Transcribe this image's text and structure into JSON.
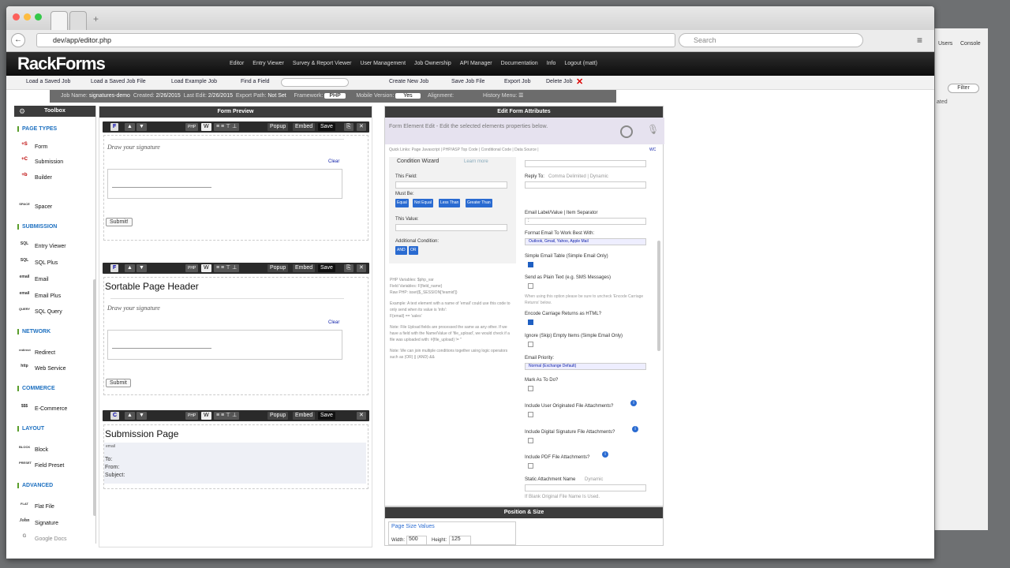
{
  "browser": {
    "url": "dev/app/editor.php",
    "search_placeholder": "Search"
  },
  "app": {
    "logo": "RackForms",
    "nav": [
      "Editor",
      "Entry Viewer",
      "Survey & Report Viewer",
      "User Management",
      "Job Ownership",
      "API Manager",
      "Documentation",
      "Info",
      "Logout (matt)"
    ]
  },
  "toolbar": {
    "load_saved_job": "Load a Saved Job",
    "load_saved_job_file": "Load a Saved Job File",
    "load_example_job": "Load Example Job",
    "find_field": "Find a Field",
    "create_new_job": "Create New Job",
    "save_job_file": "Save Job File",
    "export_job": "Export Job",
    "delete_job": "Delete Job"
  },
  "meta": {
    "job_name_label": "Job Name:",
    "job_name": "signatures-demo",
    "created_label": "Created:",
    "created": "2/26/2015",
    "last_edit_label": "Last Edit:",
    "last_edit": "2/26/2015",
    "export_path_label": "Export Path:",
    "export_path": "Not Set",
    "framework_label": "Framework:",
    "framework": "PHP",
    "mobile_label": "Mobile Version:",
    "mobile": "Yes",
    "alignment_label": "Alignment:",
    "history_label": "History Menu:"
  },
  "toolbox": {
    "title": "Toolbox",
    "sections": [
      {
        "name": "PAGE TYPES",
        "items": [
          {
            "icon": "+S",
            "label": "Form"
          },
          {
            "icon": "+C",
            "label": "Submission"
          },
          {
            "icon": "+b",
            "label": "Builder"
          }
        ]
      },
      {
        "name": "",
        "items": [
          {
            "icon": "SPACE",
            "label": "Spacer"
          }
        ]
      },
      {
        "name": "SUBMISSION",
        "items": [
          {
            "icon": "SQL",
            "label": "Entry Viewer"
          },
          {
            "icon": "SQL",
            "label": "SQL Plus"
          },
          {
            "icon": "email",
            "label": "Email"
          },
          {
            "icon": "email",
            "label": "Email Plus"
          },
          {
            "icon": "QUERY",
            "label": "SQL Query"
          }
        ]
      },
      {
        "name": "NETWORK",
        "items": [
          {
            "icon": "redirect",
            "label": "Redirect"
          },
          {
            "icon": "http",
            "label": "Web Service"
          }
        ]
      },
      {
        "name": "COMMERCE",
        "items": [
          {
            "icon": "$$$",
            "label": "E-Commerce"
          }
        ]
      },
      {
        "name": "LAYOUT",
        "items": [
          {
            "icon": "BLOCK",
            "label": "Block"
          },
          {
            "icon": "PRESET",
            "label": "Field Preset"
          }
        ]
      },
      {
        "name": "ADVANCED",
        "items": [
          {
            "icon": "FLAT",
            "label": "Flat File"
          },
          {
            "icon": "John",
            "label": "Signature"
          },
          {
            "icon": "G",
            "label": "Google Docs"
          }
        ]
      }
    ]
  },
  "preview": {
    "title": "Form Preview",
    "controls": {
      "popup": "Popup",
      "embed": "Embed",
      "save": "Save",
      "php": "PHP",
      "w": "W"
    },
    "page1": {
      "type": "F",
      "sig_label": "Draw your signature",
      "clear": "Clear",
      "submit": "Submit!"
    },
    "page2": {
      "type": "F",
      "header": "Sortable Page Header",
      "sig_label": "Draw your signature",
      "clear": "Clear",
      "submit": "Submit"
    },
    "page3": {
      "type": "C",
      "header": "Submission Page",
      "email_icon": "email",
      "to": "To:",
      "from": "From:",
      "subject": "Subject:"
    }
  },
  "editor": {
    "title": "Edit Form Attributes",
    "subtitle": "Form Element Edit - Edit the selected elements properties below.",
    "quicklinks": "Quick Links: Page Javascript | PHP/ASP Top Code | Conditional Code | Data Source |",
    "wc": "WC",
    "left": {
      "wizard": "Condition Wizard",
      "learn": "Learn more",
      "this_field": "This Field:",
      "must_be": "Must Be:",
      "ops": [
        "Equal",
        "Not Equal",
        "Less Than",
        "Greater Than"
      ],
      "this_value": "This Value:",
      "additional": "Additional Condition:",
      "and": "AND",
      "or": "OR",
      "php_vars": "PHP Variables: $php_var",
      "field_vars": "Field Variables: F{field_name}",
      "raw_php": "Raw PHP: isset($_SESSION['teamid'])",
      "p1": "Example: A text element with a name of 'email' could use this code to only send when its value is 'info':",
      "p1b": "F{email} == 'sales'",
      "p2": "Note: File Upload fields are processed the same as any other. If we have a field with the Name/Value of 'file_upload', we would check if a file was uploaded with: #{file_upload} != ''",
      "p3": "Note: We can join multiple conditions together using logic operators such as (OR) || (AND) &&"
    },
    "right": {
      "reply_to": "Reply To:",
      "reply_to_hint": "Comma Delimited | Dynamic",
      "separator": "Email Label/Value | Item Separator",
      "separator_value": ":",
      "format": "Format Email To Work Best With:",
      "format_value": "Outlook, Gmail, Yahoo, Apple Mail",
      "simple_table": "Simple Email Table (Simple Email Only)",
      "plain_text": "Send as Plain Text (e.g. SMS Messages)",
      "plain_hint": "When using this option please be sure to uncheck 'Encode Carriage Returns' below.",
      "encode": "Encode Carriage Returns as HTML?",
      "ignore": "Ignore (Skip) Empty Items (Simple Email Only)",
      "priority": "Email Priority:",
      "priority_value": "Normal (Exchange Default)",
      "todo": "Mark As To Do?",
      "user_attach": "Include User Originated File Attachments?",
      "sig_attach": "Include Digital Signature File Attachments?",
      "pdf_attach": "Include PDF File Attachments?",
      "static_name": "Static Attachment Name",
      "dynamic": "Dynamic",
      "blank_hint": "If Blank Original File Name Is Used."
    }
  },
  "possize": {
    "title": "Position & Size",
    "values": "Page Size Values",
    "width_label": "Width:",
    "width": "500",
    "height_label": "Height:",
    "height": "125"
  },
  "side": {
    "users": "Users",
    "console": "Console",
    "filter": "Filter",
    "col": "ated"
  }
}
